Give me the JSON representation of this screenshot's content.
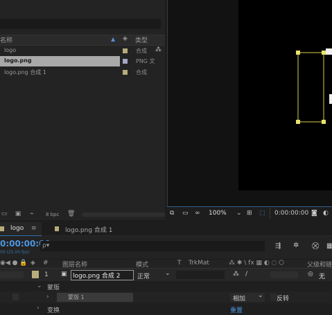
{
  "project": {
    "col_name": "名称",
    "col_type": "类型",
    "bpc": "8 bpc",
    "items": [
      {
        "name": "logo",
        "type": "合成",
        "color": "#b7ac7c"
      },
      {
        "name": "logo.png",
        "type": "PNG 文",
        "color": "#a5a6c4",
        "selected": true
      },
      {
        "name": "logo.png 合成 1",
        "type": "合成",
        "color": "#b7ac7c"
      }
    ]
  },
  "viewer": {
    "zoom": "100%",
    "timecode": "0:00:00:00"
  },
  "timeline": {
    "tabs": [
      {
        "label": "logo",
        "active": true
      },
      {
        "label": "logo.png 合成 1",
        "active": false
      }
    ],
    "current_time": "0:00:00:00",
    "fps_info": "00 (25.00 fps)",
    "search_placeholder": "ρ▾",
    "columns": {
      "num": "#",
      "layer_name": "图层名称",
      "mode": "模式",
      "t": "T",
      "trkmat": "TrkMat",
      "parent": "父级和链"
    },
    "layer": {
      "index": "1",
      "name": "logo.png 合成 2",
      "mode": "正常",
      "parent": "无",
      "label_color": "#b7ac7c"
    },
    "mask_group": "蒙版",
    "mask": {
      "name": "蒙版 1",
      "mode": "相加",
      "invert": "反转",
      "color": "#e8e26a"
    },
    "transform": "变换",
    "reset": "重置"
  }
}
